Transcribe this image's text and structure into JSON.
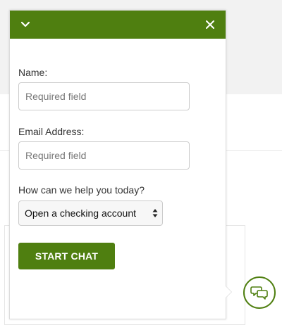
{
  "colors": {
    "accent": "#4f7f10",
    "background": "#f2f2f2",
    "panel": "#ffffff"
  },
  "chat_panel": {
    "header": {
      "minimize_icon": "chevron-down-icon",
      "close_icon": "close-icon"
    },
    "form": {
      "name": {
        "label": "Name:",
        "placeholder": "Required field"
      },
      "email": {
        "label": "Email Address:",
        "placeholder": "Required field"
      },
      "topic": {
        "label": "How can we help you today?",
        "selected": "Open a checking account"
      },
      "submit_label": "START CHAT"
    }
  },
  "launcher": {
    "icon": "chat-bubbles-icon"
  }
}
